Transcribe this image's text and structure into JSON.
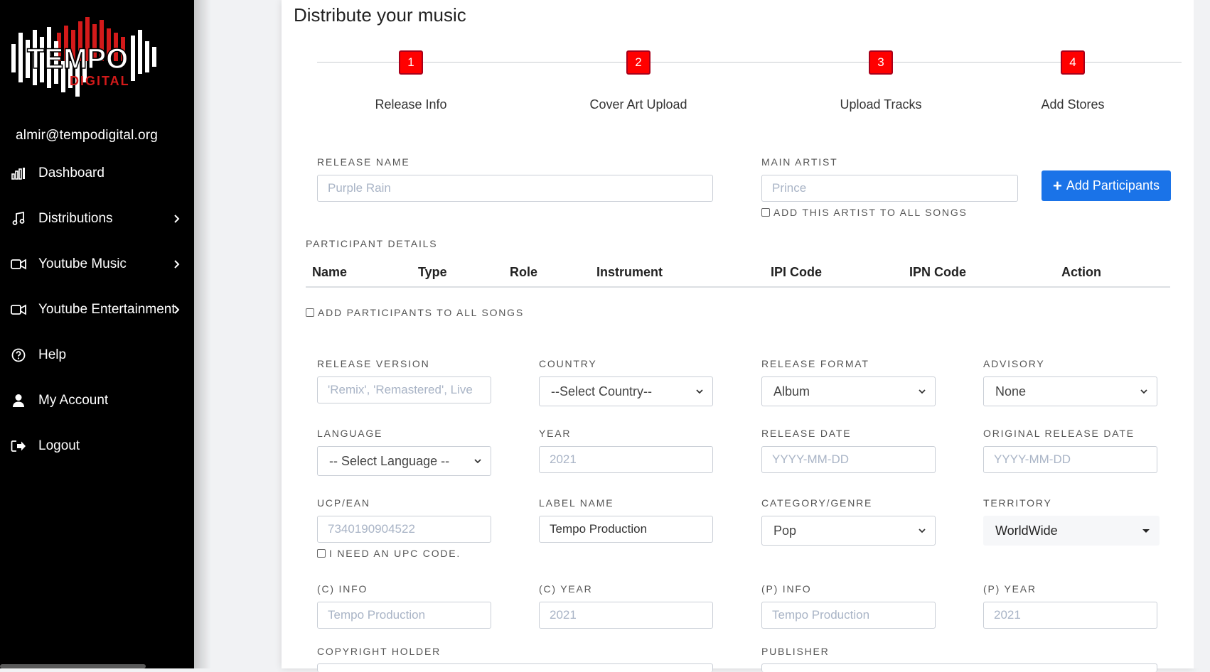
{
  "sidebar": {
    "logo": {
      "text": "TEMPO",
      "sub": "DIGITAL"
    },
    "user_email": "almir@tempodigital.org",
    "items": [
      {
        "label": "Dashboard",
        "icon": "bar-chart-icon",
        "has_submenu": false
      },
      {
        "label": "Distributions",
        "icon": "music-note-icon",
        "has_submenu": true
      },
      {
        "label": "Youtube Music",
        "icon": "video-camera-icon",
        "has_submenu": true
      },
      {
        "label": "Youtube Entertainment",
        "icon": "video-camera-icon",
        "has_submenu": true
      },
      {
        "label": "Help",
        "icon": "question-circle-icon",
        "has_submenu": false
      },
      {
        "label": "My Account",
        "icon": "user-icon",
        "has_submenu": false
      },
      {
        "label": "Logout",
        "icon": "sign-out-icon",
        "has_submenu": false
      }
    ]
  },
  "main": {
    "title": "Distribute your music",
    "steps": [
      {
        "number": "1",
        "label": "Release Info"
      },
      {
        "number": "2",
        "label": "Cover Art Upload"
      },
      {
        "number": "3",
        "label": "Upload Tracks"
      },
      {
        "number": "4",
        "label": "Add Stores"
      }
    ],
    "release_name": {
      "label": "RELEASE NAME",
      "placeholder": "Purple Rain"
    },
    "main_artist": {
      "label": "MAIN ARTIST",
      "placeholder": "Prince",
      "checkbox_label": "ADD THIS ARTIST TO ALL SONGS"
    },
    "add_participants_button": "Add Participants",
    "participant_details": {
      "label": "PARTICIPANT DETAILS",
      "columns": [
        "Name",
        "Type",
        "Role",
        "Instrument",
        "IPI Code",
        "IPN Code",
        "Action"
      ],
      "checkbox_label": "ADD PARTICIPANTS TO ALL SONGS"
    },
    "fields": {
      "release_version": {
        "label": "RELEASE VERSION",
        "placeholder": "'Remix', 'Remastered', Live"
      },
      "country": {
        "label": "COUNTRY",
        "value": "--Select Country--"
      },
      "release_format": {
        "label": "RELEASE FORMAT",
        "value": "Album"
      },
      "advisory": {
        "label": "ADVISORY",
        "value": "None"
      },
      "language": {
        "label": "LANGUAGE",
        "value": "-- Select Language --"
      },
      "year": {
        "label": "YEAR",
        "placeholder": "2021"
      },
      "release_date": {
        "label": "RELEASE DATE",
        "placeholder": "YYYY-MM-DD"
      },
      "original_release_date": {
        "label": "ORIGINAL RELEASE DATE",
        "placeholder": "YYYY-MM-DD"
      },
      "upc_ean": {
        "label": "UCP/EAN",
        "placeholder": "7340190904522",
        "checkbox_label": "I NEED AN UPC CODE."
      },
      "label_name": {
        "label": "LABEL NAME",
        "value": "Tempo Production"
      },
      "category_genre": {
        "label": "CATEGORY/GENRE",
        "value": "Pop"
      },
      "territory": {
        "label": "TERRITORY",
        "value": "WorldWide"
      },
      "c_info": {
        "label": "(C) INFO",
        "placeholder": "Tempo Production"
      },
      "c_year": {
        "label": "(C) YEAR",
        "placeholder": "2021"
      },
      "p_info": {
        "label": "(P) INFO",
        "placeholder": "Tempo Production"
      },
      "p_year": {
        "label": "(P) YEAR",
        "placeholder": "2021"
      },
      "copyright_holder": {
        "label": "COPYRIGHT HOLDER"
      },
      "publisher": {
        "label": "PUBLISHER"
      }
    }
  },
  "colors": {
    "sidebar_bg": "#000000",
    "accent_red": "#ff0000",
    "button_blue": "#1a73e8"
  }
}
